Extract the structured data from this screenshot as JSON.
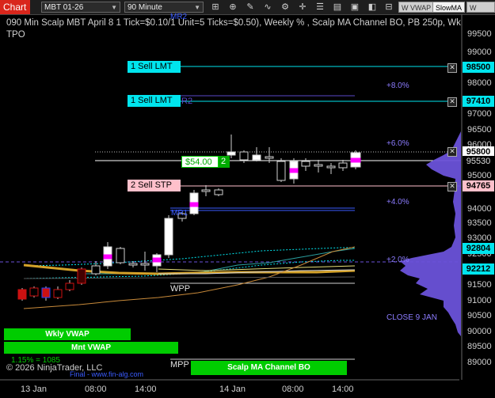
{
  "toolbar": {
    "chart_tab": "Chart",
    "instrument": "MBT 01-26",
    "interval": "90 Minute",
    "indicator_buttons": [
      "W VWAP",
      "SlowMA",
      "W VWAP"
    ]
  },
  "title_line1": "090 Min Scalp MBT April 8 1 Tick=$0.10/1 Unit=5 Ticks=$0.50), Weekly % , Scalp MA Channel BO, PB 250p, Wk",
  "title_line2": "TPO",
  "price_axis": [
    "99500",
    "99000",
    "98000",
    "97000",
    "96500",
    "96000",
    "95500",
    "95000",
    "94000",
    "93500",
    "93000",
    "92500",
    "92000",
    "91500",
    "91000",
    "90500",
    "90000",
    "89500",
    "89000"
  ],
  "price_tags": [
    {
      "text": "98500",
      "bg": "#00e5ee",
      "fg": "#000"
    },
    {
      "text": "97410",
      "bg": "#00e5ee",
      "fg": "#000"
    },
    {
      "text": "95800",
      "bg": "#ffffff",
      "fg": "#000"
    },
    {
      "text": "95530",
      "bg": "#000000",
      "fg": "#ddd"
    },
    {
      "text": "94765",
      "bg": "#ffc0cb",
      "fg": "#000"
    },
    {
      "text": "92804",
      "bg": "#00e5ee",
      "fg": "#000"
    },
    {
      "text": "92212",
      "bg": "#00e5ee",
      "fg": "#000"
    }
  ],
  "orders": {
    "sell_lmt_1": "1 Sell LMT",
    "sell_lmt_2": "1 Sell LMT",
    "sell_stp": "2 Sell STP",
    "position_pnl": "$54.00",
    "position_qty": "2"
  },
  "percent_levels": [
    "+8.0%",
    "+6.0%",
    "+4.0%",
    "+2.0%"
  ],
  "weekly_labels": {
    "top": "MR2",
    "r2": "R2",
    "mid": "MR1"
  },
  "labels": {
    "close": "CLOSE 9 JAN",
    "wpp": "WPP",
    "mpp": "MPP",
    "wkly_vwap": "Wkly VWAP",
    "mnt_vwap": "Mnt VWAP",
    "pct_note": "1.15% = 1085",
    "scalp_ma": "Scalp MA Channel BO",
    "copyright": "© 2026 NinjaTrader, LLC",
    "final": "Final - www.fin-alg.com"
  },
  "time_axis": [
    "13 Jan",
    "08:00",
    "14:00",
    "14 Jan",
    "08:00",
    "14:00"
  ],
  "colors": {
    "accent_red": "#d9261c",
    "cyan": "#00e5ee",
    "purple": "#6a52d9",
    "green": "#00cc00",
    "magenta": "#ff00ff"
  }
}
